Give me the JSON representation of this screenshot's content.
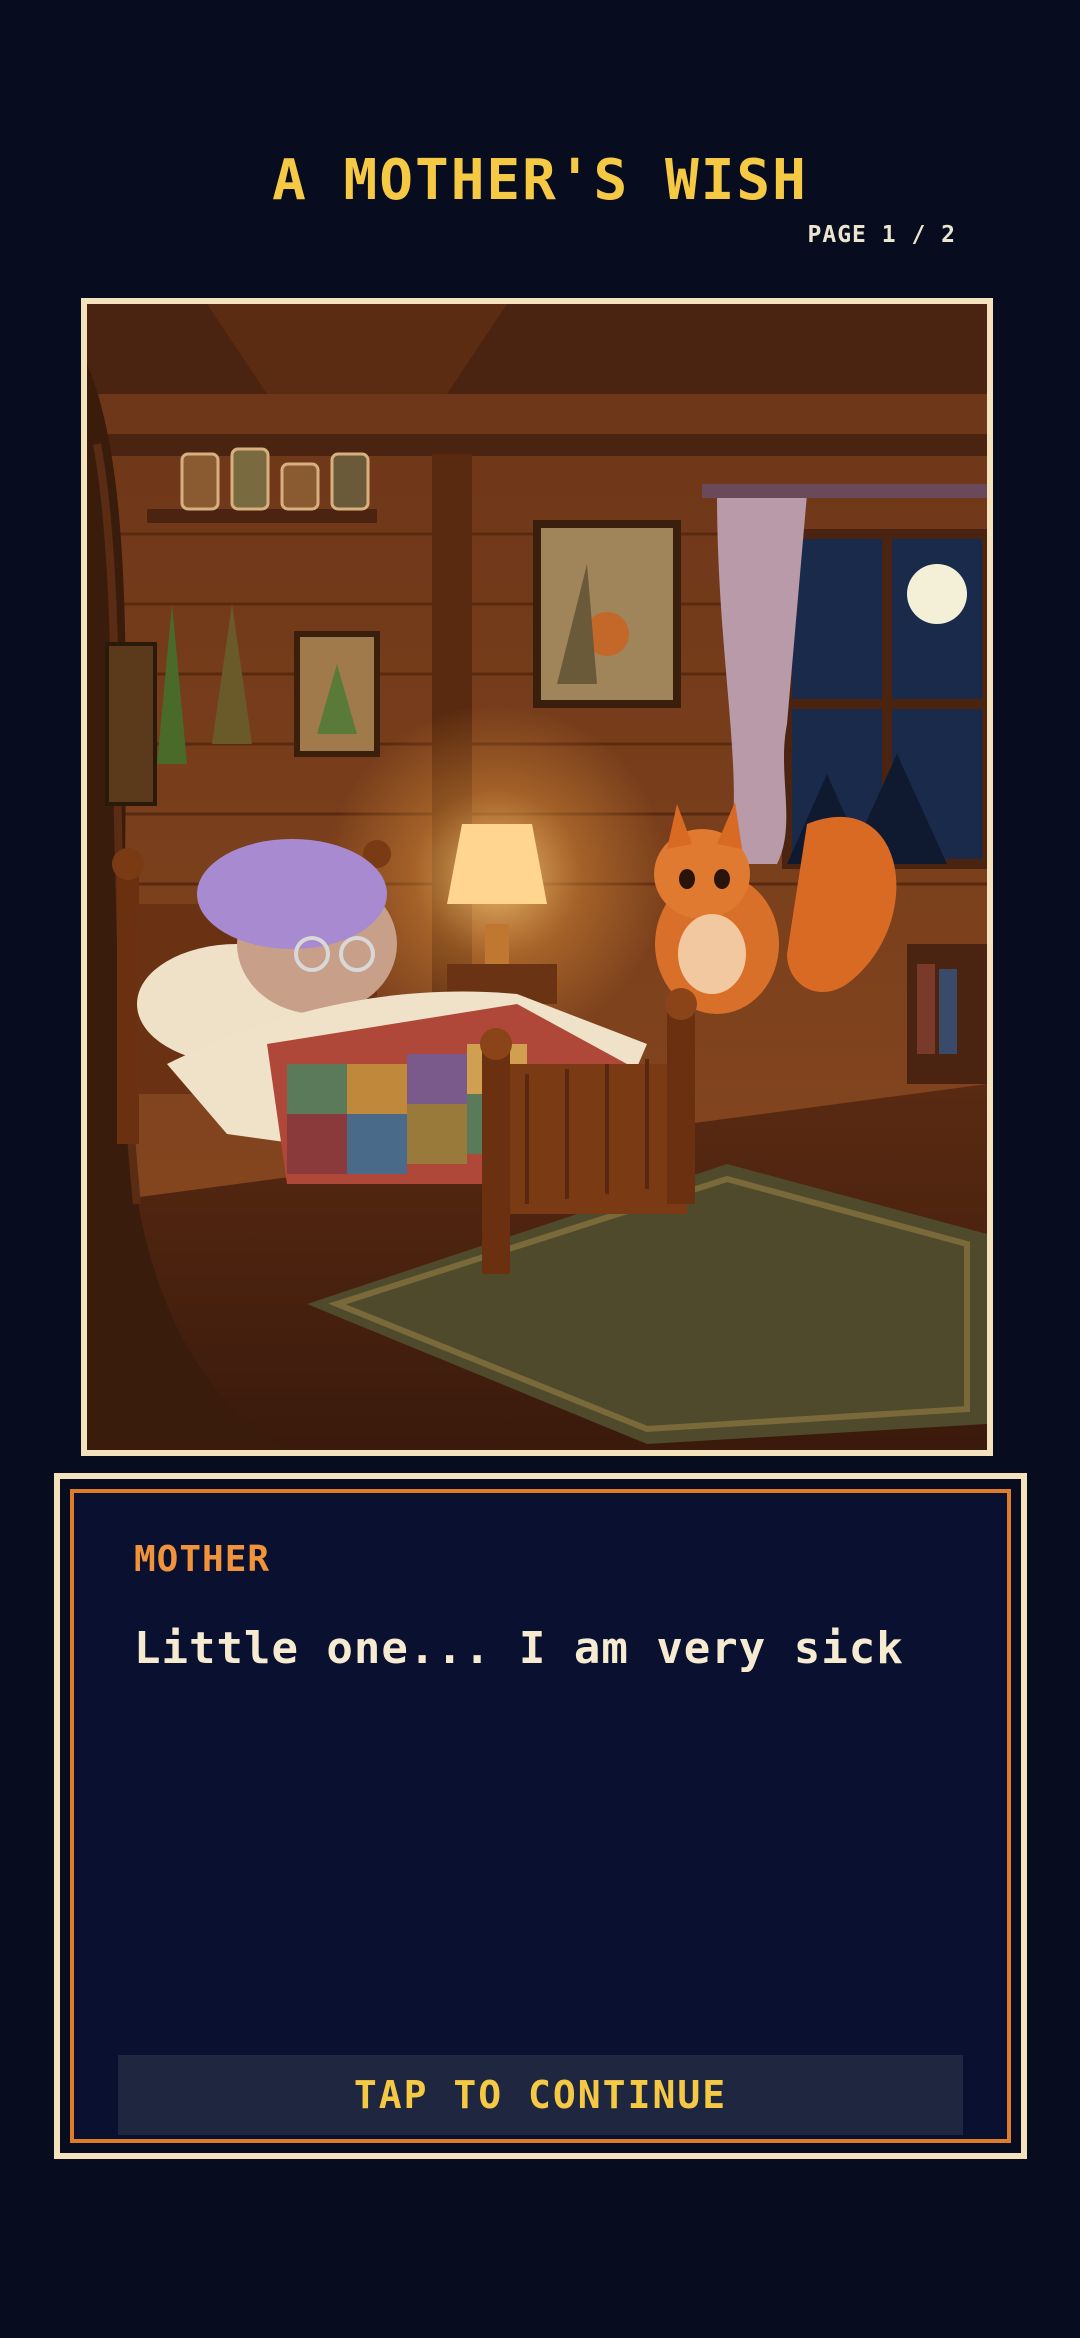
{
  "header": {
    "title": "A MOTHER'S WISH",
    "page_indicator": "PAGE 1 / 2"
  },
  "scene": {
    "description_icon": "storybook-illustration"
  },
  "dialog": {
    "speaker": "MOTHER",
    "text": "Little one... I am very sick",
    "continue_label": "TAP TO CONTINUE"
  },
  "colors": {
    "background": "#070c1f",
    "title": "#f6c945",
    "speaker": "#f0933b",
    "frame": "#f3e2bb",
    "inner_border": "#de7c2a"
  }
}
